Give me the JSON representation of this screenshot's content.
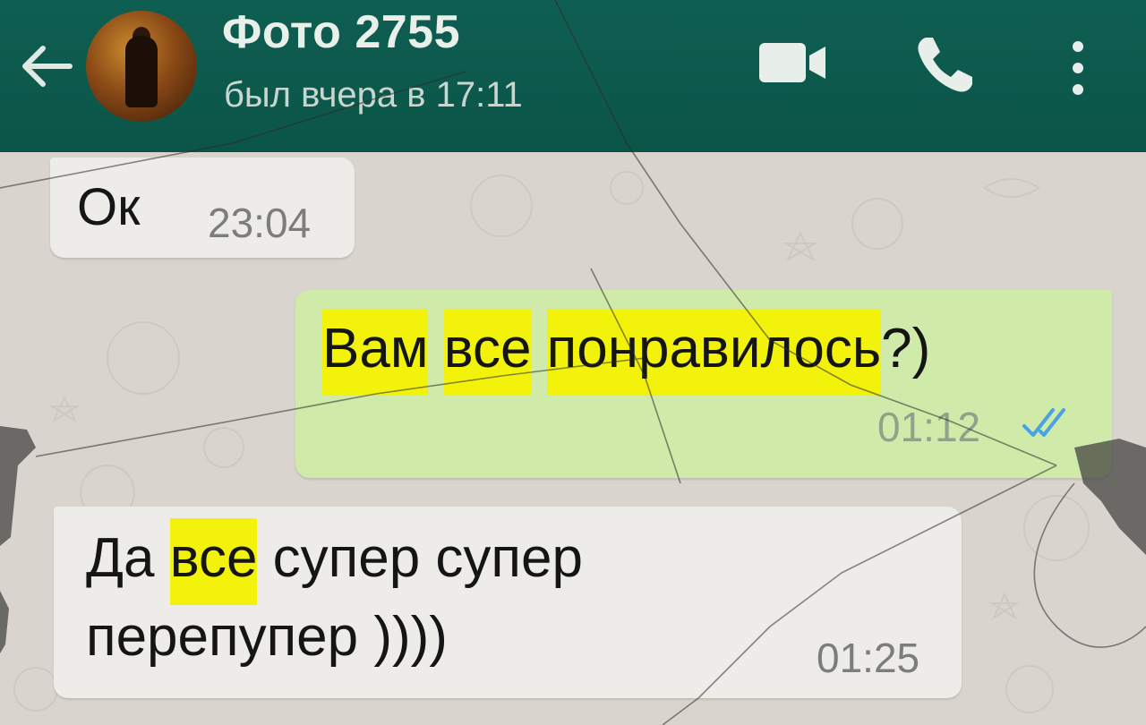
{
  "header": {
    "contact_name": "Фото 2755",
    "status": "был вчера в 17:11",
    "icons": {
      "back": "back-arrow-icon",
      "video": "video-call-icon",
      "call": "phone-call-icon",
      "menu": "more-vert-icon"
    },
    "background_color": "#0b5548"
  },
  "messages": [
    {
      "direction": "incoming",
      "text": "Ок",
      "time": "23:04"
    },
    {
      "direction": "outgoing",
      "segments": [
        {
          "text": "Вам",
          "highlighted": true
        },
        {
          "text": " ",
          "highlighted": false
        },
        {
          "text": "все",
          "highlighted": true
        },
        {
          "text": " ",
          "highlighted": false
        },
        {
          "text": "понравилось",
          "highlighted": true
        },
        {
          "text": "?)",
          "highlighted": false
        }
      ],
      "time": "01:12",
      "status_icon": "double-check-read-icon"
    },
    {
      "direction": "incoming",
      "line1_segments": [
        {
          "text": "Да ",
          "highlighted": false
        },
        {
          "text": "все",
          "highlighted": true
        },
        {
          "text": " супер супер",
          "highlighted": false
        }
      ],
      "line2": "перепупер ))))",
      "time": "01:25"
    }
  ],
  "colors": {
    "incoming_bubble": "#eeece9",
    "outgoing_bubble": "#cfeaa9",
    "highlight": "#f2f20a",
    "read_ticks": "#4aa3e0"
  }
}
